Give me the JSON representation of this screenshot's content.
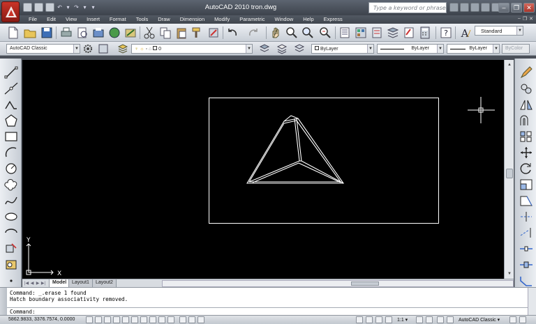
{
  "titlebar": {
    "title": "AutoCAD 2010    tron.dwg",
    "search_placeholder": "Type a keyword or phrase"
  },
  "menus": [
    "File",
    "Edit",
    "View",
    "Insert",
    "Format",
    "Tools",
    "Draw",
    "Dimension",
    "Modify",
    "Parametric",
    "Window",
    "Help",
    "Express"
  ],
  "toolbar": {
    "workspace": "AutoCAD Classic",
    "layer_value": "0",
    "color": "ByLayer",
    "linetype": "ByLayer",
    "lineweight": "ByLayer",
    "plotstyle": "ByColor",
    "text_style": "Standard"
  },
  "tabs": [
    "Model",
    "Layout1",
    "Layout2"
  ],
  "ucs": {
    "x_label": "X",
    "y_label": "Y"
  },
  "command": {
    "history": [
      "Command:  _.erase 1 found",
      "Hatch boundary associativity removed."
    ],
    "prompt": "Command:"
  },
  "status": {
    "coordinates": "5862.9833, 3376.7574, 0.0000",
    "annotation_scale": "1:1",
    "workspace": "AutoCAD Classic"
  },
  "colors": {
    "canvas": "#000000",
    "geometry": "#ffffff",
    "app_button": "#c93428",
    "chrome_dark": "#4a4f58",
    "toolbar_light": "#e6e9ee"
  }
}
